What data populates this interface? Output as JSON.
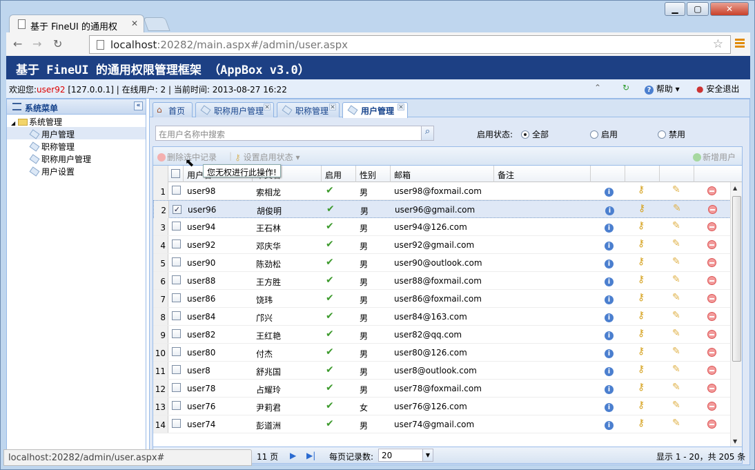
{
  "browser": {
    "tab_title": "基于 FineUI 的通用权",
    "url_host": "localhost",
    "url_rest": ":20282/main.aspx#/admin/user.aspx",
    "status_url": "localhost:20282/admin/user.aspx#"
  },
  "header": {
    "title": "基于 FineUI 的通用权限管理框架 （AppBox v3.0）"
  },
  "infobar": {
    "welcome": "欢迎您:",
    "user": "user92",
    "ip": "[127.0.0.1]",
    "online_label": "在线用户:",
    "online_count": "2",
    "time_label": "当前时间:",
    "time": "2013-08-27 16:22",
    "help": "帮助",
    "logout": "安全退出"
  },
  "sidebar": {
    "title": "系统菜单",
    "root": "系统管理",
    "items": [
      "用户管理",
      "职称管理",
      "职称用户管理",
      "用户设置"
    ]
  },
  "tabs": [
    "首页",
    "职称用户管理",
    "职称管理",
    "用户管理"
  ],
  "filter": {
    "search_placeholder": "在用户名称中搜索",
    "status_label": "启用状态:",
    "options": [
      "全部",
      "启用",
      "禁用"
    ]
  },
  "grid_toolbar": {
    "delete": "删除选中记录",
    "set_status": "设置启用状态",
    "add": "新增用户",
    "tooltip": "您无权进行此操作!"
  },
  "columns": [
    "用户名",
    "中文名",
    "启用",
    "性别",
    "邮箱",
    "备注"
  ],
  "rows": [
    {
      "n": "1",
      "user": "user98",
      "name": "索相龙",
      "sex": "男",
      "email": "user98@foxmail.com"
    },
    {
      "n": "2",
      "user": "user96",
      "name": "胡俊明",
      "sex": "男",
      "email": "user96@gmail.com"
    },
    {
      "n": "3",
      "user": "user94",
      "name": "王石林",
      "sex": "男",
      "email": "user94@126.com"
    },
    {
      "n": "4",
      "user": "user92",
      "name": "邓庆华",
      "sex": "男",
      "email": "user92@gmail.com"
    },
    {
      "n": "5",
      "user": "user90",
      "name": "陈劲松",
      "sex": "男",
      "email": "user90@outlook.com"
    },
    {
      "n": "6",
      "user": "user88",
      "name": "王方胜",
      "sex": "男",
      "email": "user88@foxmail.com"
    },
    {
      "n": "7",
      "user": "user86",
      "name": "饶玮",
      "sex": "男",
      "email": "user86@foxmail.com"
    },
    {
      "n": "8",
      "user": "user84",
      "name": "邝兴",
      "sex": "男",
      "email": "user84@163.com"
    },
    {
      "n": "9",
      "user": "user82",
      "name": "王红艳",
      "sex": "男",
      "email": "user82@qq.com"
    },
    {
      "n": "10",
      "user": "user80",
      "name": "付杰",
      "sex": "男",
      "email": "user80@126.com"
    },
    {
      "n": "11",
      "user": "user8",
      "name": "舒兆国",
      "sex": "男",
      "email": "user8@outlook.com"
    },
    {
      "n": "12",
      "user": "user78",
      "name": "占耀玲",
      "sex": "男",
      "email": "user78@foxmail.com"
    },
    {
      "n": "13",
      "user": "user76",
      "name": "尹莉君",
      "sex": "女",
      "email": "user76@126.com"
    },
    {
      "n": "14",
      "user": "user74",
      "name": "彭道洲",
      "sex": "男",
      "email": "user74@gmail.com"
    }
  ],
  "selected_row": "2",
  "pager": {
    "total_pages": "11 页",
    "page_size_label": "每页记录数:",
    "page_size": "20",
    "summary": "显示 1 - 20，共 205 条"
  }
}
